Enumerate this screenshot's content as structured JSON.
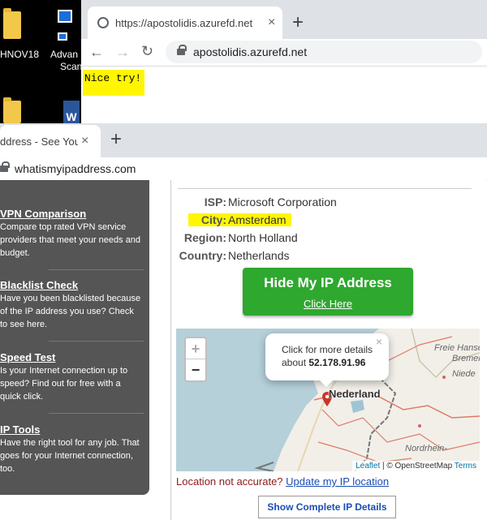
{
  "desktop": {
    "icons": [
      {
        "label": "HNOV18"
      },
      {
        "label": "Advan"
      },
      {
        "label": "Scan"
      }
    ]
  },
  "window1": {
    "tab_title": "https://apostolidis.azurefd.net",
    "tab_close": "×",
    "new_tab": "+",
    "url": "apostolidis.azurefd.net",
    "page_text": "Nice try!"
  },
  "window2": {
    "tab_title": "ddress - See Your",
    "tab_close": "×",
    "new_tab": "+",
    "url": "whatismyipaddress.com",
    "sidebar": [
      {
        "title": "VPN Comparison",
        "desc": "Compare top rated VPN service providers that meet your needs and budget."
      },
      {
        "title": "Blacklist Check",
        "desc": "Have you been blacklisted because of the IP address you use? Check to see here."
      },
      {
        "title": "Speed Test",
        "desc": "Is your Internet connection up to speed? Find out for free with a quick click."
      },
      {
        "title": "IP Tools",
        "desc": "Have the right tool for any job. That goes for your Internet connection, too."
      }
    ],
    "info": {
      "isp_label": "ISP:",
      "isp": "Microsoft Corporation",
      "city_label": "City:",
      "city": "Amsterdam",
      "region_label": "Region:",
      "region": "North Holland",
      "country_label": "Country:",
      "country": "Netherlands"
    },
    "hide_button": {
      "title": "Hide My IP Address",
      "link": "Click Here"
    },
    "map": {
      "zoom_in": "+",
      "zoom_out": "−",
      "popup_line1": "Click for more details",
      "popup_line2_prefix": "about",
      "popup_ip": "52.178.91.96",
      "popup_close": "×",
      "country_label": "Nederland",
      "labels": [
        "Freie Hanse",
        "Bremen",
        "Niede",
        "Nordrhein-"
      ],
      "attrib_leaflet": "Leaflet",
      "attrib_osm": "| © OpenStreetMap",
      "attrib_terms": "Terms"
    },
    "location_q": "Location not accurate?",
    "location_link": "Update my IP location",
    "details_button": "Show Complete IP Details"
  },
  "colors": {
    "highlight": "#fff600",
    "green_button": "#2fa82f",
    "sidebar_bg": "#555555"
  }
}
